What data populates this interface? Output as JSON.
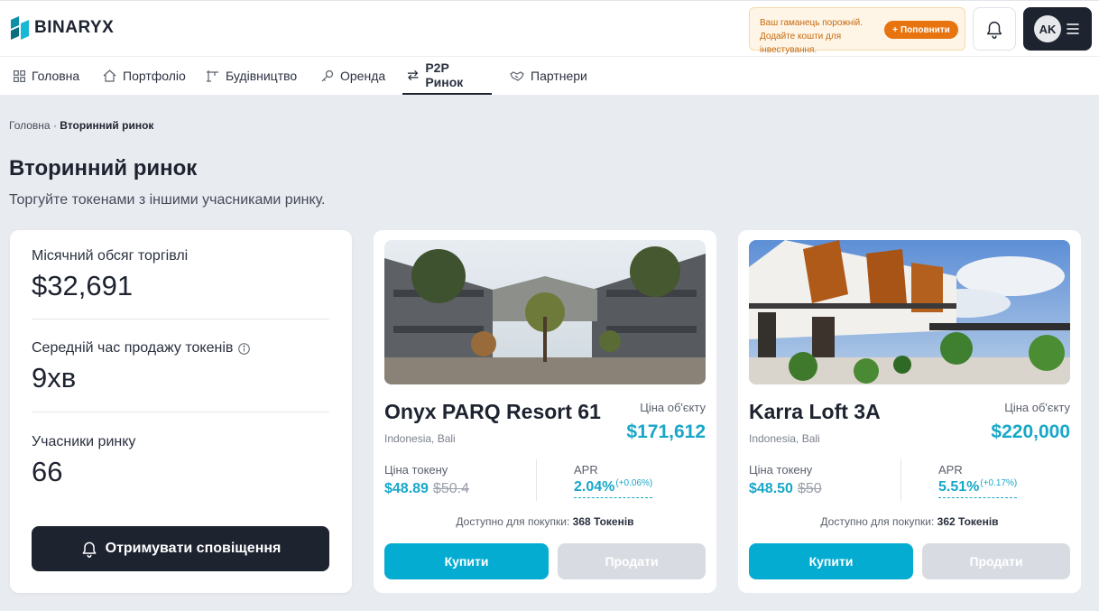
{
  "header": {
    "brand": "BINARYX",
    "wallet_alert": "Ваш гаманець порожній. Додайте кошти для інвестування.",
    "topup_label": "Поповнити",
    "user_initials": "AK"
  },
  "nav": [
    {
      "label": "Головна",
      "icon": "grid-icon"
    },
    {
      "label": "Портфоліо",
      "icon": "home-icon"
    },
    {
      "label": "Будівництво",
      "icon": "crane-icon"
    },
    {
      "label": "Оренда",
      "icon": "key-icon"
    },
    {
      "label": "P2P Ринок",
      "icon": "swap-icon",
      "active": true
    },
    {
      "label": "Партнери",
      "icon": "handshake-icon"
    }
  ],
  "breadcrumb": {
    "home": "Головна",
    "sep": "·",
    "current": "Вторинний ринок"
  },
  "page": {
    "title": "Вторинний ринок",
    "subtitle": "Торгуйте токенами з іншими учасниками ринку."
  },
  "stats": {
    "monthly_volume_label": "Місячний обсяг торгівлі",
    "monthly_volume_value": "$32,691",
    "avg_sell_time_label": "Середній час продажу токенів",
    "avg_sell_time_value": "9хв",
    "participants_label": "Учасники ринку",
    "participants_value": "66",
    "notify_label": "Отримувати сповіщення"
  },
  "properties": [
    {
      "name": "Onyx PARQ Resort 61",
      "location": "Indonesia, Bali",
      "price_label": "Ціна об'єкту",
      "price": "$171,612",
      "token_label": "Ціна токену",
      "token_price": "$48.89",
      "token_old_price": "$50.4",
      "apr_label": "APR",
      "apr": "2.04%",
      "apr_change": "(+0.06%)",
      "available_label": "Доступно для покупки:",
      "available_value": "368 Токенів",
      "buy_label": "Купити",
      "sell_label": "Продати"
    },
    {
      "name": "Karra Loft 3A",
      "location": "Indonesia, Bali",
      "price_label": "Ціна об'єкту",
      "price": "$220,000",
      "token_label": "Ціна токену",
      "token_price": "$48.50",
      "token_old_price": "$50",
      "apr_label": "APR",
      "apr": "5.51%",
      "apr_change": "(+0.17%)",
      "available_label": "Доступно для покупки:",
      "available_value": "362 Токенів",
      "buy_label": "Купити",
      "sell_label": "Продати"
    }
  ],
  "colors": {
    "accent": "#05acd1",
    "dark": "#1e2330",
    "warning_bg": "#fff5e6",
    "warning_btn": "#e8740f"
  }
}
